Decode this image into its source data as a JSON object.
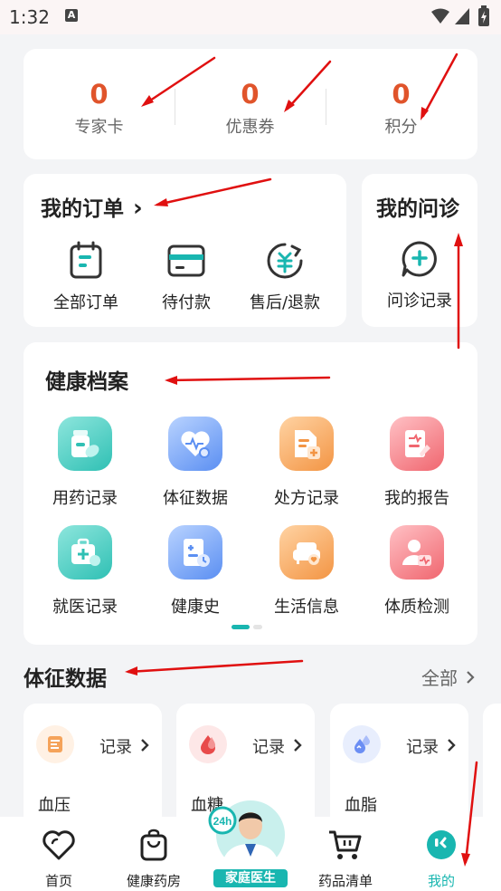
{
  "status_bar": {
    "time": "1:32",
    "notification_letter": "A"
  },
  "stats": [
    {
      "value": "0",
      "label": "专家卡"
    },
    {
      "value": "0",
      "label": "优惠券"
    },
    {
      "value": "0",
      "label": "积分"
    }
  ],
  "orders": {
    "title": "我的订单",
    "chevron": "›",
    "items": [
      {
        "label": "全部订单",
        "icon": "clipboard-icon"
      },
      {
        "label": "待付款",
        "icon": "card-icon"
      },
      {
        "label": "售后/退款",
        "icon": "refund-icon"
      }
    ]
  },
  "consult": {
    "title": "我的问诊",
    "item_label": "问诊记录",
    "icon": "chat-plus-icon"
  },
  "health_archive": {
    "title": "健康档案",
    "items": [
      {
        "label": "用药记录",
        "icon": "medicine-icon",
        "color": "#3cc9be"
      },
      {
        "label": "体征数据",
        "icon": "heart-monitor-icon",
        "color": "#6b9cf4"
      },
      {
        "label": "处方记录",
        "icon": "prescription-icon",
        "color": "#f5a35a"
      },
      {
        "label": "我的报告",
        "icon": "report-icon",
        "color": "#f47b82"
      },
      {
        "label": "就医记录",
        "icon": "medical-kit-icon",
        "color": "#3cc9be"
      },
      {
        "label": "健康史",
        "icon": "history-icon",
        "color": "#6b9cf4"
      },
      {
        "label": "生活信息",
        "icon": "sofa-icon",
        "color": "#f5a35a"
      },
      {
        "label": "体质检测",
        "icon": "person-check-icon",
        "color": "#f47b82"
      }
    ]
  },
  "vitals": {
    "title": "体征数据",
    "all_label": "全部",
    "cards": [
      {
        "name": "血压",
        "record_label": "记录",
        "icon": "blood-pressure-icon",
        "color": "#f5a35a"
      },
      {
        "name": "血糖",
        "record_label": "记录",
        "icon": "blood-drop-icon",
        "color": "#e84a4a"
      },
      {
        "name": "血脂",
        "record_label": "记录",
        "icon": "lipid-drop-icon",
        "color": "#6b8ef4"
      }
    ]
  },
  "tabbar": {
    "items": [
      {
        "label": "首页",
        "icon": "heart-icon"
      },
      {
        "label": "健康药房",
        "icon": "bag-icon"
      },
      {
        "label": "家庭医生",
        "icon": "doctor-avatar-icon",
        "badge": "24h"
      },
      {
        "label": "药品清单",
        "icon": "cart-icon"
      },
      {
        "label": "我的",
        "icon": "profile-icon",
        "active": true
      }
    ],
    "active_color": "#19b6b0"
  },
  "colors": {
    "accent": "#19b6b0",
    "stat_number": "#e0542b",
    "annotation_arrow": "#e01010"
  }
}
